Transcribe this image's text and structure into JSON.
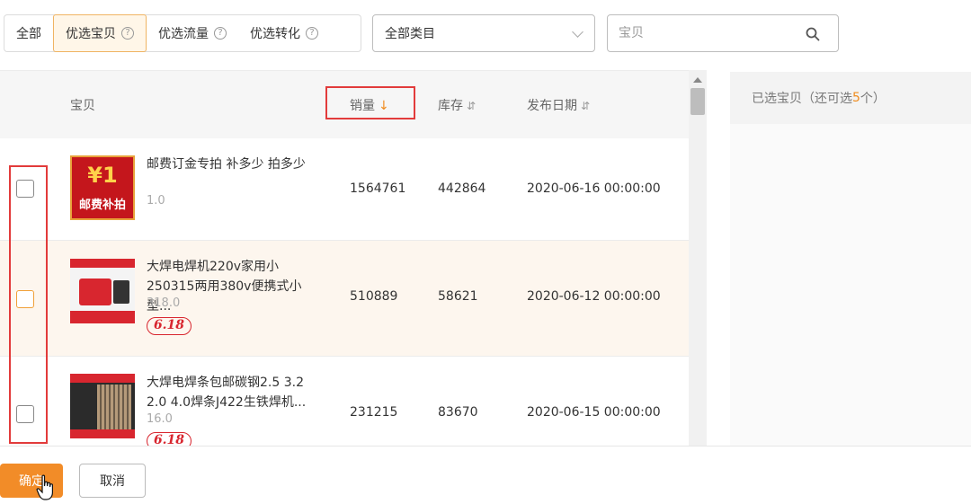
{
  "tabs": [
    {
      "label": "全部",
      "help": false
    },
    {
      "label": "优选宝贝",
      "help": true,
      "active": true
    },
    {
      "label": "优选流量",
      "help": true
    },
    {
      "label": "优选转化",
      "help": true
    }
  ],
  "help_glyph": "?",
  "category": {
    "value": "全部类目"
  },
  "search": {
    "placeholder": "宝贝"
  },
  "table": {
    "headers": {
      "item": "宝贝",
      "sales": "销量",
      "sales_sort": "↓",
      "stock": "库存",
      "stock_sort": "⇵",
      "date": "发布日期",
      "date_sort": "⇵"
    },
    "rows": [
      {
        "title": "邮费订金专拍 补多少 拍多少",
        "price": "1.0",
        "sales": "1564761",
        "stock": "442864",
        "date": "2020-06-16 00:00:00",
        "thumb": {
          "big": "¥1",
          "text": "邮费补拍"
        }
      },
      {
        "title": "大焊电焊机220v家用小250315两用380v便携式小型...",
        "price": "318.0",
        "sales": "510889",
        "stock": "58621",
        "date": "2020-06-12 00:00:00",
        "badge": "6.18"
      },
      {
        "title": "大焊电焊条包邮碳钢2.5 3.2 2.0 4.0焊条J422生铁焊机...",
        "price": "16.0",
        "sales": "231215",
        "stock": "83670",
        "date": "2020-06-15 00:00:00",
        "badge": "6.18"
      }
    ]
  },
  "selected": {
    "prefix": "已选宝贝（还可选",
    "count": "5",
    "suffix": "个）"
  },
  "footer": {
    "ok_label": "确定",
    "cancel_label": "取消"
  },
  "colors": {
    "accent": "#f28c28",
    "highlight": "#e23b3b",
    "badge": "#d8262f"
  }
}
